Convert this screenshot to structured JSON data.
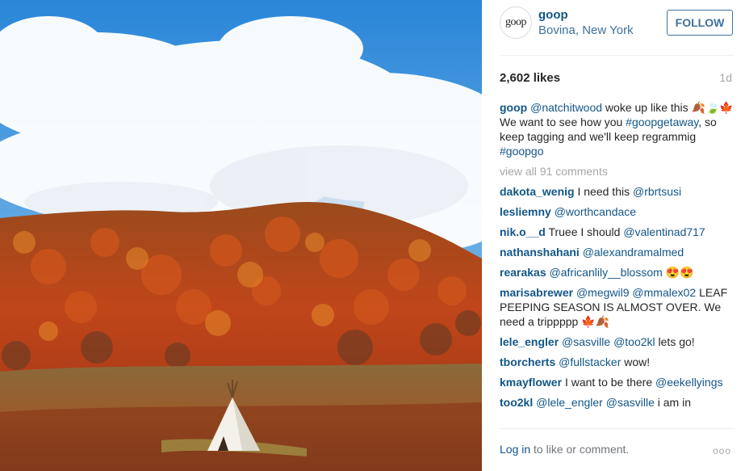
{
  "post": {
    "username": "goop",
    "avatar_text": "goop",
    "location": "Bovina, New York",
    "follow_label": "FOLLOW",
    "likes": "2,602 likes",
    "age": "1d",
    "caption": {
      "user": "goop",
      "parts": [
        {
          "t": "@natchitwood",
          "m": true
        },
        {
          "t": " woke up like this 🍂🍃🍁 We want to see how you ",
          "m": false
        },
        {
          "t": "#goopgetaway",
          "m": true
        },
        {
          "t": ", so keep tagging and we'll keep regrammig ",
          "m": false
        },
        {
          "t": "#goopgo",
          "m": true
        }
      ]
    },
    "view_all": "view all 91 comments",
    "comments": [
      {
        "user": "dakota_wenig",
        "parts": [
          {
            "t": "I need this ",
            "m": false
          },
          {
            "t": "@rbrtsusi",
            "m": true
          }
        ]
      },
      {
        "user": "lesliemny",
        "parts": [
          {
            "t": "@worthcandace",
            "m": true
          }
        ]
      },
      {
        "user": "nik.o__d",
        "parts": [
          {
            "t": "Truee I should ",
            "m": false
          },
          {
            "t": "@valentinad717",
            "m": true
          }
        ]
      },
      {
        "user": "nathanshahani",
        "parts": [
          {
            "t": "@alexandramalmed",
            "m": true
          }
        ]
      },
      {
        "user": "rearakas",
        "parts": [
          {
            "t": "@africanlily__blossom",
            "m": true
          },
          {
            "t": " 😍😍",
            "m": false
          }
        ]
      },
      {
        "user": "marisabrewer",
        "parts": [
          {
            "t": "@megwil9",
            "m": true
          },
          {
            "t": " ",
            "m": false
          },
          {
            "t": "@mmalex02",
            "m": true
          },
          {
            "t": " LEAF PEEPING SEASON IS ALMOST OVER. We need a trippppp 🍁🍂",
            "m": false
          }
        ]
      },
      {
        "user": "lele_engler",
        "parts": [
          {
            "t": "@sasville",
            "m": true
          },
          {
            "t": " ",
            "m": false
          },
          {
            "t": "@too2kl",
            "m": true
          },
          {
            "t": " lets go!",
            "m": false
          }
        ]
      },
      {
        "user": "tborcherts",
        "parts": [
          {
            "t": "@fullstacker",
            "m": true
          },
          {
            "t": " wow!",
            "m": false
          }
        ]
      },
      {
        "user": "kmayflower",
        "parts": [
          {
            "t": "I want to be there ",
            "m": false
          },
          {
            "t": "@eekellyings",
            "m": true
          }
        ]
      },
      {
        "user": "too2kl",
        "parts": [
          {
            "t": "@lele_engler",
            "m": true
          },
          {
            "t": " ",
            "m": false
          },
          {
            "t": "@sasville",
            "m": true
          },
          {
            "t": " i am in",
            "m": false
          }
        ]
      }
    ],
    "footer": {
      "login": "Log in",
      "rest": " to like or comment.",
      "more": "ooo"
    }
  },
  "colors": {
    "link_dark": "#125688",
    "link_light": "#3f729b",
    "muted": "#a5a7aa"
  },
  "icons": [
    "leaf-icon",
    "more-options-icon"
  ]
}
